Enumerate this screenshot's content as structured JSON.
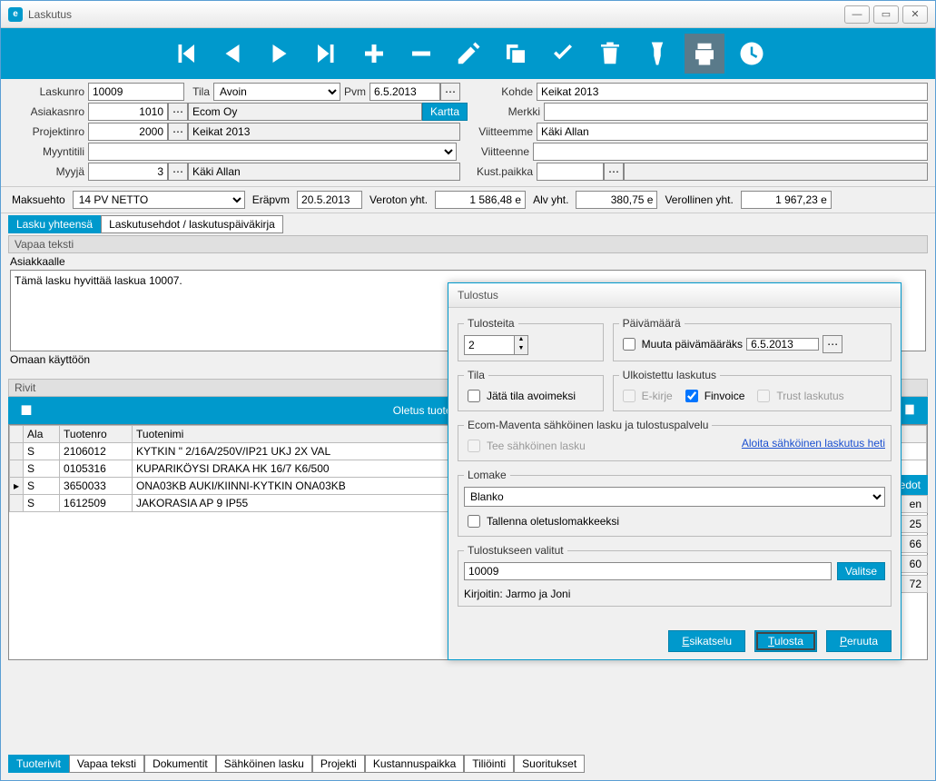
{
  "window": {
    "title": "Laskutus"
  },
  "form": {
    "laskunro_label": "Laskunro",
    "laskunro": "10009",
    "tila_label": "Tila",
    "tila": "Avoin",
    "pvm_label": "Pvm",
    "pvm": "6.5.2013",
    "kohde_label": "Kohde",
    "kohde": "Keikat 2013",
    "asiakasnro_label": "Asiakasnro",
    "asiakasnro": "1010",
    "asiakas_name": "Ecom Oy",
    "kartta_btn": "Kartta",
    "merkki_label": "Merkki",
    "merkki": "",
    "projektinro_label": "Projektinro",
    "projektinro": "2000",
    "projekti_name": "Keikat 2013",
    "viitteemme_label": "Viitteemme",
    "viitteemme": "Käki Allan",
    "myyntitili_label": "Myyntitili",
    "myyntitili": "",
    "viitteenne_label": "Viitteenne",
    "viitteenne": "",
    "myyja_label": "Myyjä",
    "myyja_no": "3",
    "myyja_name": "Käki Allan",
    "kustpaikka_label": "Kust.paikka",
    "kustpaikka": ""
  },
  "sums": {
    "maksuehto_label": "Maksuehto",
    "maksuehto": "14 PV NETTO",
    "erapvm_label": "Eräpvm",
    "erapvm": "20.5.2013",
    "veroton_label": "Veroton yht.",
    "veroton": "1 586,48 e",
    "alv_label": "Alv yht.",
    "alv": "380,75 e",
    "verollinen_label": "Verollinen yht.",
    "verollinen": "1 967,23 e"
  },
  "tabs1": {
    "t1": "Lasku yhteensä",
    "t2": "Laskutusehdot / laskutuspäiväkirja"
  },
  "free": {
    "section": "Vapaa teksti",
    "asiakkaalle": "Asiakkaalle",
    "text": "Tämä lasku hyvittää laskua 10007.",
    "omaan": "Omaan käyttöön"
  },
  "rows": {
    "section": "Rivit",
    "toolbar_mode": "Oletus tuoteala (S)",
    "cols": {
      "ala": "Ala",
      "tuotenro": "Tuotenro",
      "tuotenimi": "Tuotenimi"
    },
    "data": [
      {
        "ala": "S",
        "no": "2106012",
        "name": "KYTKIN \" 2/16A/250V/IP21 UKJ 2X VAL"
      },
      {
        "ala": "S",
        "no": "0105316",
        "name": "KUPARIKÖYSI DRAKA HK 16/7 K6/500"
      },
      {
        "ala": "S",
        "no": "3650033",
        "name": "ONA03KB AUKI/KIINNI-KYTKIN ONA03KB"
      },
      {
        "ala": "S",
        "no": "1612509",
        "name": "JAKORASIA AP 9 IP55"
      }
    ]
  },
  "rightcol": {
    "header": "atiedot",
    "vals": [
      "en",
      "25",
      "66",
      "60",
      "72"
    ]
  },
  "btabs": [
    "Tuoterivit",
    "Vapaa teksti",
    "Dokumentit",
    "Sähköinen lasku",
    "Projekti",
    "Kustannuspaikka",
    "Tiliöinti",
    "Suoritukset"
  ],
  "dialog": {
    "title": "Tulostus",
    "tulosteita_label": "Tulosteita",
    "tulosteita": "2",
    "paivamaara_label": "Päivämäärä",
    "muuta_pvm": "Muuta päivämääräks",
    "pvm": "6.5.2013",
    "tila_label": "Tila",
    "jata_avoimeksi": "Jätä tila avoimeksi",
    "ulkoistettu_label": "Ulkoistettu laskutus",
    "ekirje": "E-kirje",
    "finvoice": "Finvoice",
    "trust": "Trust laskutus",
    "maventa_label": "Ecom-Maventa sähköinen lasku ja tulostuspalvelu",
    "tee_sahkoinen": "Tee sähköinen lasku",
    "aloita_link": "Aloita sähköinen laskutus heti",
    "lomake_label": "Lomake",
    "lomake": "Blanko",
    "tallenna_oletus": "Tallenna oletuslomakkeeksi",
    "valitut_label": "Tulostukseen valitut",
    "valitut": "10009",
    "valitse_btn": "Valitse",
    "kirjoitin": "Kirjoitin: Jarmo ja Joni",
    "esikatselu": "Esikatselu",
    "tulosta": "Tulosta",
    "peruuta": "Peruuta"
  }
}
